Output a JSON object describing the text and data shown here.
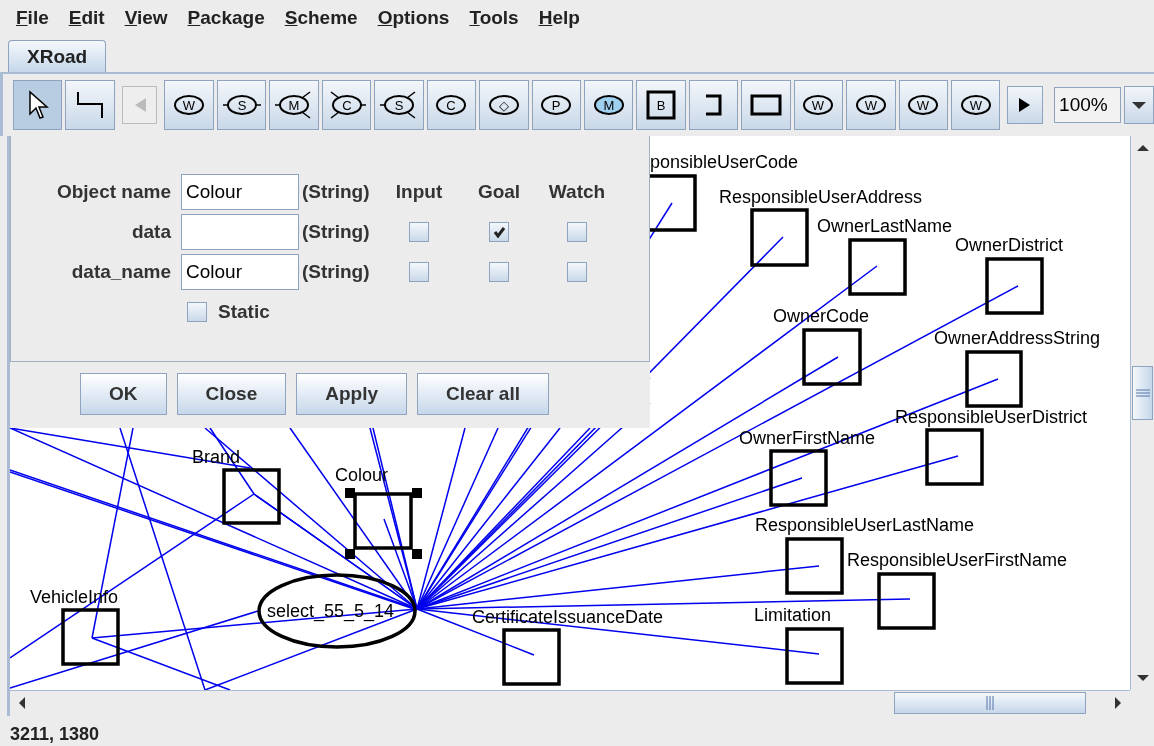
{
  "menu": [
    {
      "label": "File"
    },
    {
      "label": "Edit"
    },
    {
      "label": "View"
    },
    {
      "label": "Package"
    },
    {
      "label": "Scheme"
    },
    {
      "label": "Options"
    },
    {
      "label": "Tools"
    },
    {
      "label": "Help"
    }
  ],
  "tabs": [
    {
      "label": "XRoad",
      "selected": true
    }
  ],
  "toolbar": {
    "modes": [
      {
        "kind": "pointer",
        "selected": true
      },
      {
        "kind": "connector",
        "selected": false
      }
    ],
    "scroll_left": {
      "disabled": true
    },
    "tools": [
      {
        "kind": "oval",
        "label": "W"
      },
      {
        "kind": "oval-stubs",
        "label": "S"
      },
      {
        "kind": "oval-cross-right",
        "label": "M"
      },
      {
        "kind": "oval-cross-left",
        "label": "C"
      },
      {
        "kind": "oval-cross-right",
        "label": "S"
      },
      {
        "kind": "oval",
        "label": "C"
      },
      {
        "kind": "oval",
        "label": "◇"
      },
      {
        "kind": "oval",
        "label": "P"
      },
      {
        "kind": "oval-filled",
        "label": "M"
      },
      {
        "kind": "box-letter",
        "label": "B"
      },
      {
        "kind": "bracket"
      },
      {
        "kind": "rect"
      },
      {
        "kind": "oval",
        "label": "W"
      },
      {
        "kind": "oval",
        "label": "W"
      },
      {
        "kind": "oval",
        "label": "W"
      },
      {
        "kind": "oval",
        "label": "W"
      }
    ],
    "scroll_right": {
      "disabled": false
    },
    "zoom": "100%"
  },
  "diagram": {
    "nodes": [
      {
        "kind": "box",
        "label": "ponsibleUserCode",
        "selected": false
      },
      {
        "kind": "box",
        "label": "ResponsibleUserAddress",
        "selected": false
      },
      {
        "kind": "box",
        "label": "OwnerLastName",
        "selected": false
      },
      {
        "kind": "box",
        "label": "OwnerDistrict",
        "selected": false
      },
      {
        "kind": "box",
        "label": "OwnerCode",
        "selected": false
      },
      {
        "kind": "box",
        "label": "OwnerAddressString",
        "selected": false
      },
      {
        "kind": "box",
        "label": "ResponsibleUserDistrict",
        "selected": false
      },
      {
        "kind": "box",
        "label": "OwnerFirstName",
        "selected": false
      },
      {
        "kind": "box",
        "label": "ResponsibleUserLastName",
        "selected": false
      },
      {
        "kind": "box",
        "label": "ResponsibleUserFirstName",
        "selected": false
      },
      {
        "kind": "box",
        "label": "CertificateIssuanceDate",
        "selected": false
      },
      {
        "kind": "box",
        "label": "Limitation",
        "selected": false
      },
      {
        "kind": "box",
        "label": "Brand",
        "selected": false
      },
      {
        "kind": "box",
        "label": "Colour",
        "selected": true
      },
      {
        "kind": "box",
        "label": "VehicleInfo",
        "selected": false
      },
      {
        "kind": "ellipse",
        "label": "select_55_5_14",
        "selected": false
      }
    ]
  },
  "dialog": {
    "columns": [
      "Input",
      "Goal",
      "Watch"
    ],
    "rows": [
      {
        "label": "Object name",
        "value": "Colour",
        "type": "(String)"
      },
      {
        "label": "data",
        "type": "(String)",
        "input": false,
        "goal": true,
        "watch": false
      },
      {
        "label": "data_name",
        "value": "Colour",
        "type": "(String)",
        "input": false,
        "goal": false,
        "watch": false
      }
    ],
    "static": {
      "label": "Static",
      "checked": false
    },
    "buttons": [
      "OK",
      "Close",
      "Apply",
      "Clear all"
    ]
  },
  "status_bar": "3211, 1380"
}
